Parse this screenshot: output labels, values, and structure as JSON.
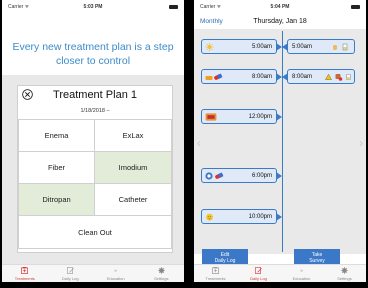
{
  "left_screen": {
    "status": {
      "carrier": "Carrier ᯤ",
      "time": "5:03 PM"
    },
    "headline": "Every new treatment plan is a step closer to control",
    "plan": {
      "title": "Treatment Plan 1",
      "date": "1/18/2018 –",
      "options": [
        {
          "label": "Enema",
          "selected": false
        },
        {
          "label": "ExLax",
          "selected": false
        },
        {
          "label": "Fiber",
          "selected": false
        },
        {
          "label": "Imodium",
          "selected": true
        },
        {
          "label": "Ditropan",
          "selected": true
        },
        {
          "label": "Catheter",
          "selected": false
        },
        {
          "label": "Clean Out",
          "selected": false
        }
      ]
    },
    "page_dots": {
      "count": 2,
      "active": 0
    },
    "tabs": [
      {
        "label": "Treatments",
        "icon": "treatments-icon",
        "active": true
      },
      {
        "label": "Daily Log",
        "icon": "daily-log-icon",
        "active": false
      },
      {
        "label": "Education",
        "icon": "education-icon",
        "active": false
      },
      {
        "label": "Settings",
        "icon": "gear-icon",
        "active": false
      }
    ]
  },
  "right_screen": {
    "status": {
      "carrier": "Carrier ᯤ",
      "time": "5:04 PM"
    },
    "nav": {
      "monthly_label": "Monthly",
      "date": "Thursday, Jan 18"
    },
    "timeline": [
      {
        "time": "5:00am",
        "left_icons": [
          "sun-icon"
        ],
        "right": {
          "time": "5:00am",
          "icons": [
            "hand-icon",
            "cup-icon"
          ]
        }
      },
      {
        "time": "8:00am",
        "left_icons": [
          "bottle-icon",
          "pill-icon"
        ],
        "right": {
          "time": "8:00am",
          "icons": [
            "warning-icon",
            "toilet-icon",
            "cup-icon"
          ]
        }
      },
      {
        "time": "12:00pm",
        "left_icons": [
          "lunch-icon"
        ],
        "right": null
      },
      {
        "time": "6:00pm",
        "left_icons": [
          "catheter-icon",
          "pill-icon"
        ],
        "right": null
      },
      {
        "time": "10:00pm",
        "left_icons": [
          "moon-icon"
        ],
        "right": null
      }
    ],
    "edit_button": "Edit\nDaily Log",
    "take_survey_button": "Take\nSurvey",
    "tabs": [
      {
        "label": "Treatments",
        "icon": "treatments-icon",
        "active": false
      },
      {
        "label": "Daily Log",
        "icon": "daily-log-icon",
        "active": true
      },
      {
        "label": "Education",
        "icon": "education-icon",
        "active": false
      },
      {
        "label": "Settings",
        "icon": "gear-icon",
        "active": false
      }
    ]
  },
  "colors": {
    "accent": "#3b78c8",
    "headline": "#3d8bc9",
    "selected_option": "#e2ecd9",
    "active_tab": "#dd3333",
    "bubble_fill": "#dfe9f7"
  }
}
